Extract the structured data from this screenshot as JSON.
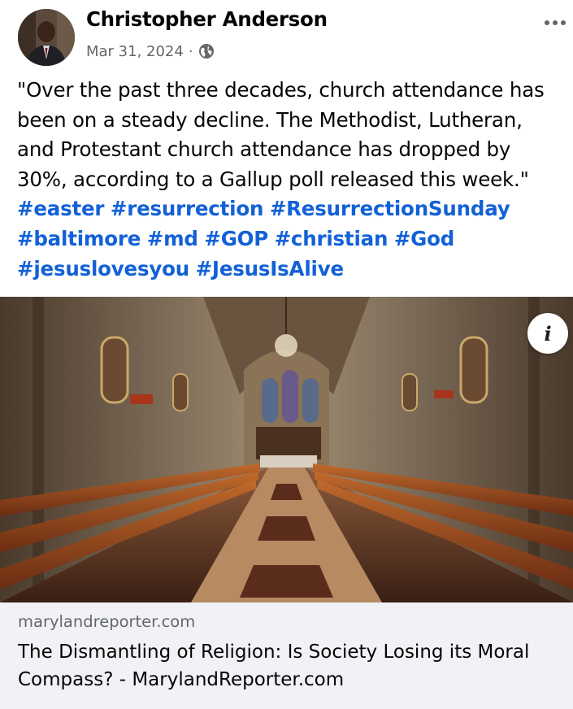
{
  "post": {
    "author": "Christopher Anderson",
    "date": "Mar 31, 2024",
    "separator": "·",
    "privacy_icon": "globe-icon",
    "more_icon": "more-options-icon",
    "text": "\"Over the past three decades, church attendance has been on a steady decline. The Methodist, Lutheran, and Protestant church attendance has dropped by 30%, according to a Gallup poll released this week.\"",
    "hashtags": [
      "#easter",
      "#resurrection",
      "#ResurrectionSunday",
      "#baltimore",
      "#md",
      "#GOP",
      "#christian",
      "#God",
      "#jesuslovesyou",
      "#JesusIsAlive"
    ]
  },
  "link": {
    "image_description_icon": "church-interior-image",
    "info_icon": "info-icon",
    "info_glyph": "i",
    "domain": "marylandreporter.com",
    "title": "The Dismantling of Religion: Is Society Losing its Moral Compass? - MarylandReporter.com"
  },
  "colors": {
    "hashtag": "#1361d6",
    "secondary_text": "#65676b",
    "link_background": "#f0f2f5"
  }
}
